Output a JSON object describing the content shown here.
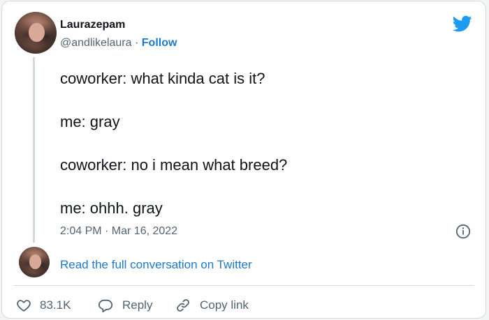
{
  "tweet": {
    "author_name": "Laurazepam",
    "handle": "@andlikelaura",
    "separator": "·",
    "follow_label": "Follow",
    "lines": [
      "coworker: what kinda cat is it?",
      "me: gray",
      "coworker: no i mean what breed?",
      "me: ohhh. gray"
    ],
    "timestamp": "2:04 PM · Mar 16, 2022",
    "read_conversation_label": "Read the full conversation on Twitter"
  },
  "actions": {
    "like_count": "83.1K",
    "reply_label": "Reply",
    "copy_link_label": "Copy link"
  },
  "icons": {
    "brand": "twitter-bird-icon",
    "info": "info-icon",
    "like": "heart-icon",
    "reply": "speech-bubble-icon",
    "copy_link": "link-icon"
  },
  "colors": {
    "link_blue": "#1d79cd",
    "twitter_blue": "#1d9bf0",
    "muted_text": "#536471"
  }
}
